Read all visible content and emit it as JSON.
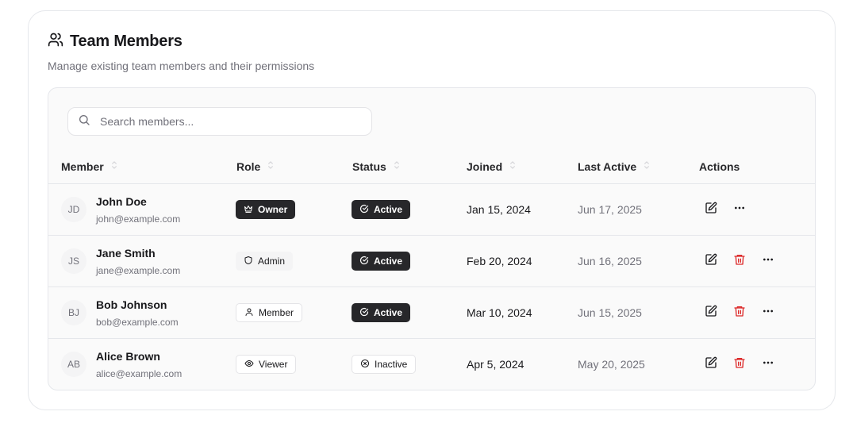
{
  "header": {
    "title": "Team Members",
    "subtitle": "Manage existing team members and their permissions"
  },
  "search": {
    "placeholder": "Search members...",
    "value": ""
  },
  "columns": {
    "member": "Member",
    "role": "Role",
    "status": "Status",
    "joined": "Joined",
    "last_active": "Last Active",
    "actions": "Actions"
  },
  "members": [
    {
      "initials": "JD",
      "name": "John Doe",
      "email": "john@example.com",
      "role": "Owner",
      "role_icon": "crown-icon",
      "status": "Active",
      "joined": "Jan 15, 2024",
      "last_active": "Jun 17, 2025"
    },
    {
      "initials": "JS",
      "name": "Jane Smith",
      "email": "jane@example.com",
      "role": "Admin",
      "role_icon": "shield-icon",
      "status": "Active",
      "joined": "Feb 20, 2024",
      "last_active": "Jun 16, 2025"
    },
    {
      "initials": "BJ",
      "name": "Bob Johnson",
      "email": "bob@example.com",
      "role": "Member",
      "role_icon": "user-icon",
      "status": "Active",
      "joined": "Mar 10, 2024",
      "last_active": "Jun 15, 2025"
    },
    {
      "initials": "AB",
      "name": "Alice Brown",
      "email": "alice@example.com",
      "role": "Viewer",
      "role_icon": "eye-icon",
      "status": "Inactive",
      "joined": "Apr 5, 2024",
      "last_active": "May 20, 2025"
    }
  ],
  "colors": {
    "accent_dark": "#27272a",
    "danger": "#dc2626",
    "muted": "#71717a"
  }
}
